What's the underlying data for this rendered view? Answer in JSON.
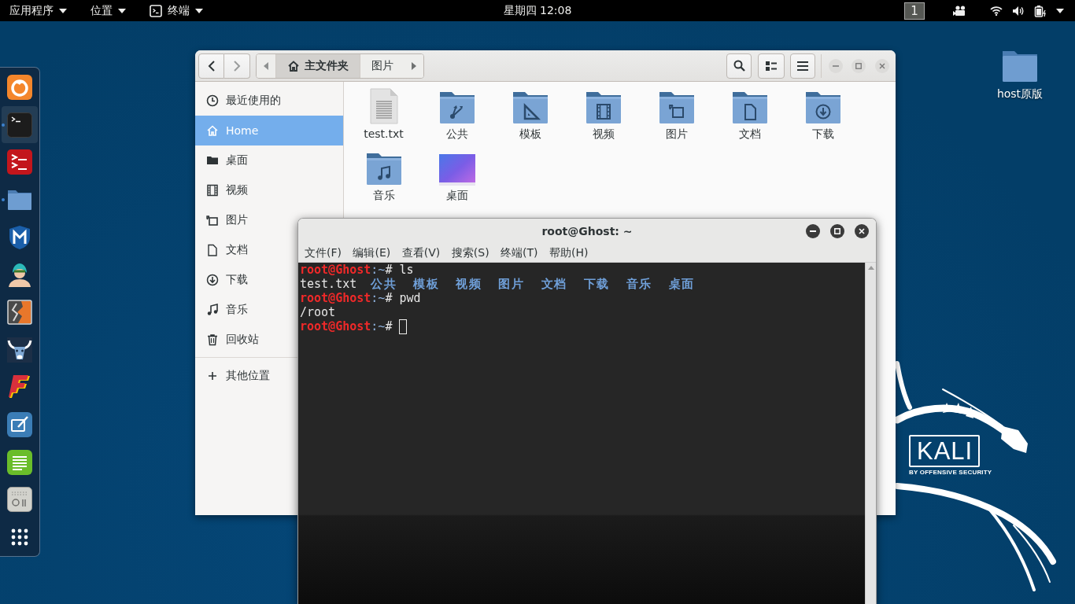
{
  "top_bar": {
    "menus": [
      {
        "label": "应用程序",
        "kind": "menu"
      },
      {
        "label": "位置",
        "kind": "menu"
      },
      {
        "label": "终端",
        "kind": "app"
      }
    ],
    "clock": "星期四 12:08",
    "workspace": "1"
  },
  "dock": {
    "items": [
      {
        "kind": "browser",
        "running": false,
        "highlighted": false
      },
      {
        "kind": "terminal",
        "running": true,
        "highlighted": true
      },
      {
        "kind": "console",
        "running": false,
        "highlighted": false
      },
      {
        "kind": "folder",
        "running": true,
        "highlighted": false
      },
      {
        "kind": "shield",
        "running": false,
        "highlighted": false
      },
      {
        "kind": "avatar",
        "running": false,
        "highlighted": false
      },
      {
        "kind": "split",
        "running": false,
        "highlighted": false
      },
      {
        "kind": "bull",
        "running": false,
        "highlighted": false
      },
      {
        "kind": "zigzag",
        "running": false,
        "highlighted": false
      },
      {
        "kind": "tablet",
        "running": false,
        "highlighted": false
      },
      {
        "kind": "notes",
        "running": false,
        "highlighted": false
      },
      {
        "kind": "device",
        "running": false,
        "highlighted": false
      },
      {
        "kind": "grid",
        "running": false,
        "highlighted": false
      }
    ]
  },
  "file_manager": {
    "navigation": {
      "back": {
        "disabled": false
      },
      "forward": {
        "disabled": true
      }
    },
    "path_bar": [
      {
        "label": "主文件夹",
        "kind": "home",
        "selected": true
      },
      {
        "label": "图片",
        "kind": "folder",
        "selected": false
      }
    ],
    "sidebar": {
      "places": [
        {
          "label": "最近使用的",
          "kind": "recent",
          "selected": false
        },
        {
          "label": "Home",
          "kind": "home",
          "selected": true
        },
        {
          "label": "桌面",
          "kind": "desktop",
          "selected": false
        },
        {
          "label": "视频",
          "kind": "video",
          "selected": false
        },
        {
          "label": "图片",
          "kind": "pictures",
          "selected": false
        },
        {
          "label": "文档",
          "kind": "document",
          "selected": false
        },
        {
          "label": "下载",
          "kind": "download",
          "selected": false
        },
        {
          "label": "音乐",
          "kind": "music",
          "selected": false
        },
        {
          "label": "回收站",
          "kind": "trash",
          "selected": false
        }
      ],
      "other": {
        "label": "其他位置"
      }
    },
    "files": [
      {
        "name": "test.txt",
        "kind": "text"
      },
      {
        "name": "公共",
        "kind": "share"
      },
      {
        "name": "模板",
        "kind": "template"
      },
      {
        "name": "视频",
        "kind": "video"
      },
      {
        "name": "图片",
        "kind": "pictures"
      },
      {
        "name": "文档",
        "kind": "document"
      },
      {
        "name": "下载",
        "kind": "download"
      },
      {
        "name": "音乐",
        "kind": "music"
      },
      {
        "name": "桌面",
        "kind": "image"
      }
    ]
  },
  "terminal": {
    "title": "root@Ghost: ~",
    "menu": [
      "文件(F)",
      "编辑(E)",
      "查看(V)",
      "搜索(S)",
      "终端(T)",
      "帮助(H)"
    ],
    "lines": [
      {
        "segments": [
          {
            "text": "root@Ghost",
            "kind": "user"
          },
          {
            "text": ":~",
            "kind": "path"
          },
          {
            "text": "# ls",
            "kind": "plain"
          }
        ],
        "cursor": false
      },
      {
        "segments": [
          {
            "text": "test.txt  ",
            "kind": "plain"
          },
          {
            "text": "公共  模板  视频  图片  文档  下载  音乐  桌面",
            "kind": "dir"
          }
        ],
        "cursor": false
      },
      {
        "segments": [
          {
            "text": "root@Ghost",
            "kind": "user"
          },
          {
            "text": ":~",
            "kind": "path"
          },
          {
            "text": "# pwd",
            "kind": "plain"
          }
        ],
        "cursor": false
      },
      {
        "segments": [
          {
            "text": "/root",
            "kind": "plain"
          }
        ],
        "cursor": false
      },
      {
        "segments": [
          {
            "text": "root@Ghost",
            "kind": "user"
          },
          {
            "text": ":~",
            "kind": "path"
          },
          {
            "text": "# ",
            "kind": "plain"
          }
        ],
        "cursor": true
      }
    ]
  },
  "desktop": {
    "icons": [
      {
        "label": "host原版"
      }
    ],
    "logo": {
      "title": "KALI",
      "subtitle": "BY OFFENSIVE SECURITY"
    }
  }
}
